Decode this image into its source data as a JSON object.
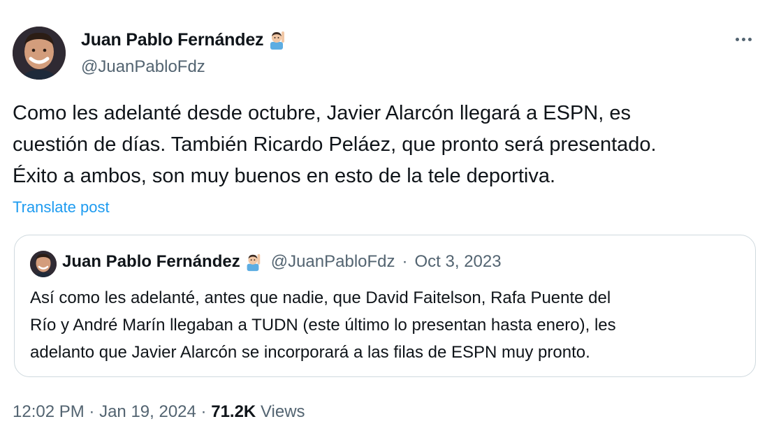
{
  "author": {
    "display_name": "Juan Pablo Fernández",
    "handle": "@JuanPabloFdz",
    "badge_icon": "person-raising-hand-emoji"
  },
  "tweet": {
    "text_lines": [
      "Como les adelanté desde octubre, Javier Alarcón llegará a ESPN, es",
      "cuestión de días. También Ricardo Peláez, que pronto será presentado.",
      "Éxito a ambos, son muy buenos en esto de la tele deportiva."
    ],
    "translate_label": "Translate post",
    "more_icon": "more-options-icon"
  },
  "quote": {
    "display_name": "Juan Pablo Fernández",
    "handle": "@JuanPabloFdz",
    "separator": "·",
    "date": "Oct 3, 2023",
    "text_lines": [
      "Así como les adelanté, antes que nadie, que David Faitelson, Rafa Puente del",
      "Río y André Marín llegaban a TUDN (este último lo presentan hasta enero), les",
      "adelanto que Javier Alarcón se incorporará a las filas de ESPN muy pronto."
    ]
  },
  "footer": {
    "time": "12:02 PM",
    "separator": "·",
    "date": "Jan 19, 2024",
    "views_count": "71.2K",
    "views_label": "Views"
  },
  "colors": {
    "link": "#1d9bf0",
    "secondary_text": "#536471",
    "primary_text": "#0f1419",
    "border": "#cfd9de"
  }
}
